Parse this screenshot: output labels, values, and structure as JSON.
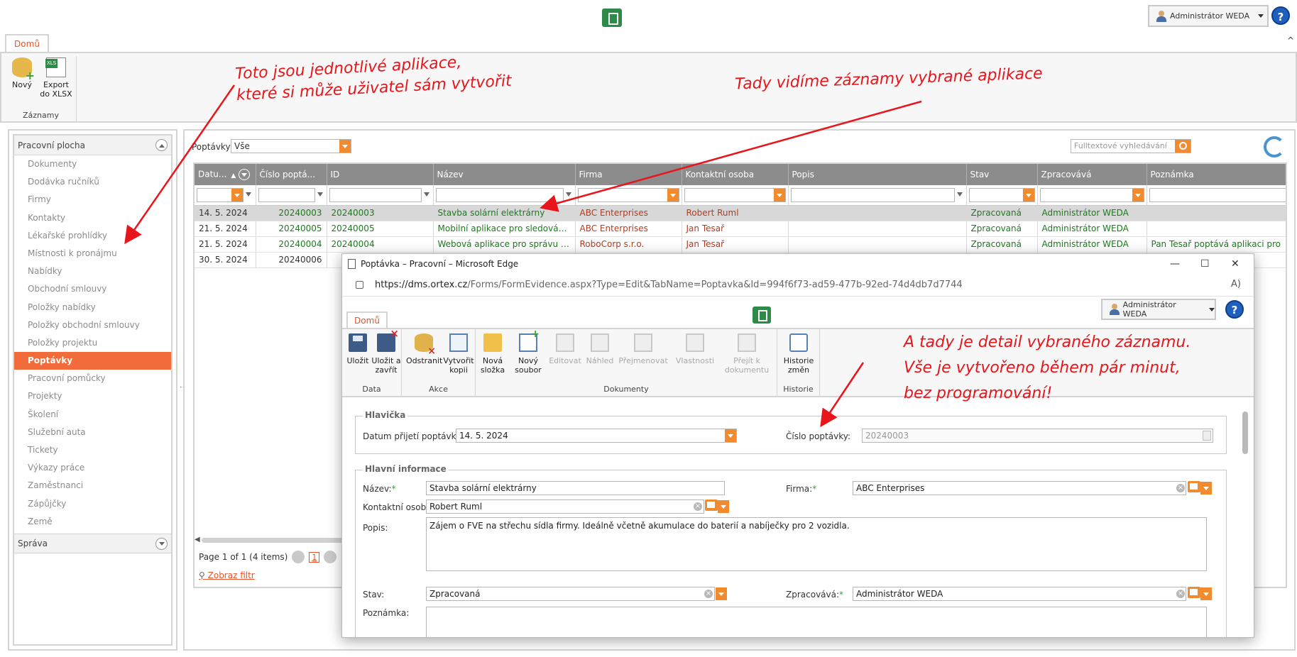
{
  "top": {
    "user_name": "Administrátor WEDA",
    "help_label": "?"
  },
  "ribbon": {
    "tab_label": "Domů",
    "buttons": [
      {
        "label": "Nový"
      },
      {
        "label": "Export do XLSX"
      }
    ],
    "group_label": "Záznamy"
  },
  "sidebar": {
    "section_title": "Pracovní plocha",
    "items": [
      "Dokumenty",
      "Dodávka ručníků",
      "Firmy",
      "Kontakty",
      "Lékařské prohlídky",
      "Místnosti k pronájmu",
      "Nabídky",
      "Obchodní smlouvy",
      "Položky nabídky",
      "Položky obchodní smlouvy",
      "Položky projektu",
      "Poptávky",
      "Pracovní pomůcky",
      "Projekty",
      "Školení",
      "Služební auta",
      "Tickety",
      "Výkazy práce",
      "Zaměstnanci",
      "Zápůjčky",
      "Země"
    ],
    "active_item": "Poptávky",
    "footer_title": "Správa"
  },
  "main": {
    "filter_label": "Poptávky",
    "filter_value": "Vše",
    "fulltext_placeholder": "Fulltextové vyhledávání",
    "columns": [
      "Datu...",
      "Číslo poptá...",
      "ID",
      "Název",
      "Firma",
      "Kontaktní osoba",
      "Popis",
      "Stav",
      "Zpracovává",
      "Poznámka"
    ],
    "rows": [
      [
        "14. 5. 2024",
        "20240003",
        "20240003",
        "Stavba solární elektrárny",
        "ABC Enterprises",
        "Robert Ruml",
        "",
        "Zpracovaná",
        "Administrátor WEDA",
        ""
      ],
      [
        "21. 5. 2024",
        "20240005",
        "20240005",
        "Mobilní aplikace pro sledování...",
        "ABC Enterprises",
        "Jan Tesař",
        "",
        "Zpracovaná",
        "Administrátor WEDA",
        ""
      ],
      [
        "21. 5. 2024",
        "20240004",
        "20240004",
        "Webová aplikace pro správu ú...",
        "RoboCorp s.r.o.",
        "Jan Tesař",
        "",
        "Zpracovaná",
        "Administrátor WEDA",
        "Pan Tesař poptává aplikaci pro"
      ],
      [
        "30. 5. 2024",
        "20240006",
        "",
        "",
        "",
        "",
        "",
        "",
        "",
        ""
      ]
    ],
    "pager_text": "Page 1 of 1 (4 items)",
    "pager_page": "1",
    "show_filter": "Zobraz filtr"
  },
  "popup": {
    "window_title": "Poptávka – Pracovní – Microsoft Edge",
    "url_host": "https://dms.ortex.cz",
    "url_path": "/Forms/FormEvidence.aspx?Type=Edit&TabName=Poptavka&Id=994f6f73-ad59-477b-92ed-74d4db7d7744",
    "user_name": "Administrátor WEDA",
    "tab_label": "Domů",
    "groups": [
      {
        "label": "Data",
        "buttons": [
          "Uložit",
          "Uložit a zavřít"
        ]
      },
      {
        "label": "Akce",
        "buttons": [
          "Odstranit",
          "Vytvořit kopii"
        ]
      },
      {
        "label": "Dokumenty",
        "buttons": [
          "Nová složka",
          "Nový soubor",
          "Editovat",
          "Náhled",
          "Přejmenovat",
          "Vlastnosti",
          "Přejít k dokumentu"
        ]
      },
      {
        "label": "Historie",
        "buttons": [
          "Historie změn"
        ]
      }
    ],
    "form": {
      "section_header": "Hlavička",
      "date_label": "Datum přijetí poptávky:",
      "date_value": "14. 5. 2024",
      "number_label": "Číslo poptávky:",
      "number_value": "20240003",
      "section_main": "Hlavní informace",
      "name_label": "Název:",
      "name_value": "Stavba solární elektrárny",
      "company_label": "Firma:",
      "company_value": "ABC Enterprises",
      "contact_label": "Kontaktní osoba:",
      "contact_value": "Robert Ruml",
      "desc_label": "Popis:",
      "desc_value": "Zájem o FVE na střechu sídla firmy. Ideálně včetně akumulace do baterií a nabíječky pro 2 vozidla.",
      "state_label": "Stav:",
      "state_value": "Zpracovaná",
      "handler_label": "Zpracovává:",
      "handler_value": "Administrátor WEDA",
      "note_label": "Poznámka:"
    }
  },
  "annotations": {
    "apps": [
      "Toto jsou jednotlivé aplikace,",
      "které si může uživatel sám vytvořit"
    ],
    "records": "Tady vidíme záznamy vybrané aplikace",
    "detail": [
      "A tady je detail vybraného záznamu.",
      "Vše je vytvořeno během pár minut,",
      "bez programování!"
    ]
  },
  "colors": {
    "accent": "#f26b3a",
    "annotation": "#e8161b",
    "header_gray": "#8c8c8c",
    "green_text": "#1e7a1e",
    "red_text": "#b83a1c"
  }
}
